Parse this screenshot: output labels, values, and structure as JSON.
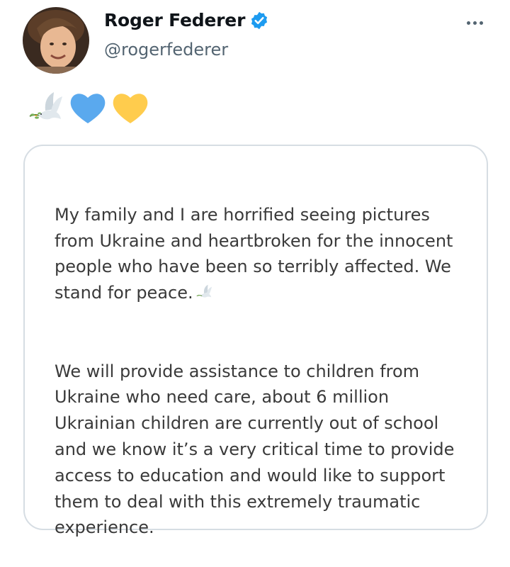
{
  "tweet": {
    "author": {
      "display_name": "Roger Federer",
      "handle": "@rogerfederer",
      "verified": true,
      "avatar_icon": "avatar-photo"
    },
    "more_icon": "more-horizontal-icon",
    "emoji": [
      "dove-with-olive-branch-icon",
      "blue-heart-icon",
      "yellow-heart-icon"
    ],
    "colors": {
      "blue_heart": "#5aa9ee",
      "yellow_heart": "#ffcc4d",
      "verified": "#1d9bf0",
      "secondary_text": "#536471"
    },
    "card": {
      "paragraph1": "My family and I are horrified seeing pictures from Ukraine and heartbroken for the innocent people who have been so terribly affected. We stand for peace.",
      "paragraph2": "We will provide assistance to children from Ukraine who need care, about 6 million Ukrainian children are currently out of school and we know it’s a very critical time to provide access to education and would like to support them to deal with this extremely traumatic experience."
    }
  }
}
